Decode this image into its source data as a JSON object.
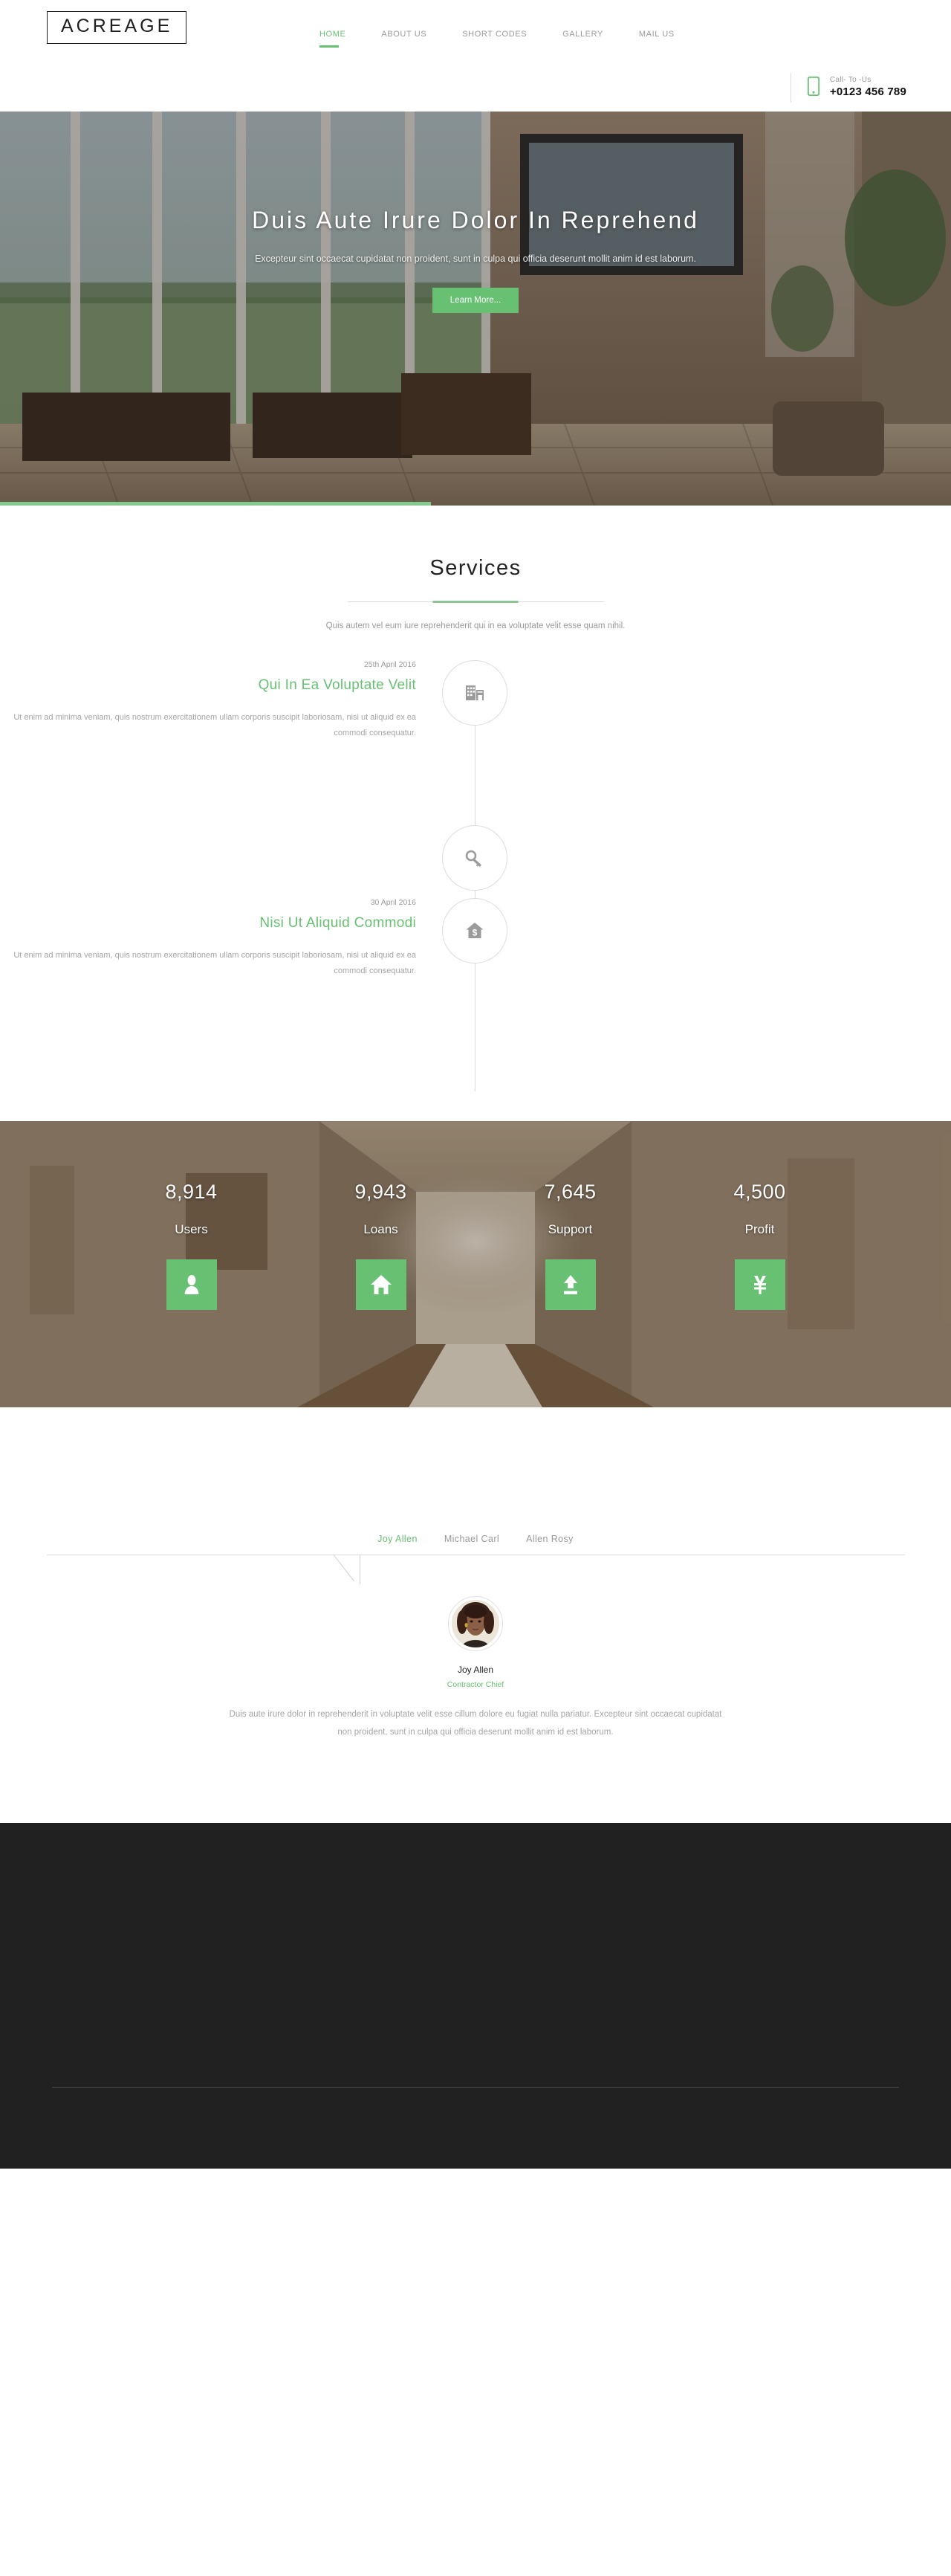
{
  "header": {
    "logo": "ACREAGE",
    "nav": [
      {
        "label": "HOME",
        "active": true
      },
      {
        "label": "ABOUT US",
        "active": false
      },
      {
        "label": "SHORT CODES",
        "active": false
      },
      {
        "label": "GALLERY",
        "active": false
      },
      {
        "label": "MAIL US",
        "active": false
      }
    ],
    "call": {
      "icon": "mobile-phone-icon",
      "label": "Call- To -Us",
      "number": "+0123 456 789"
    }
  },
  "hero": {
    "title": "Duis Aute Irure Dolor In Reprehend",
    "subtitle": "Excepteur sint occaecat cupidatat non proident, sunt in culpa qui officia deserunt mollit anim id est laborum.",
    "button": "Learn More...",
    "progress_percent": 45,
    "accent": "#68c073"
  },
  "services": {
    "title": "Services",
    "subtitle": "Quis autem vel eum iure reprehenderit qui in ea voluptate velit esse quam nihil.",
    "items": [
      {
        "date": "25th April 2016",
        "heading": "Qui In Ea Voluptate Velit",
        "body": "Ut enim ad minima veniam, quis nostrum exercitationem ullam corporis suscipit laboriosam, nisi ut aliquid ex ea commodi consequatur.",
        "icon": "office-building-icon"
      },
      {
        "date": "",
        "heading": "",
        "body": "",
        "icon": "key-icon"
      },
      {
        "date": "30 April 2016",
        "heading": "Nisi Ut Aliquid Commodi",
        "body": "Ut enim ad minima veniam, quis nostrum exercitationem ullam corporis suscipit laboriosam, nisi ut aliquid ex ea commodi consequatur.",
        "icon": "house-dollar-icon"
      }
    ]
  },
  "counters": [
    {
      "value": "8,914",
      "label": "Users",
      "icon": "user-icon"
    },
    {
      "value": "9,943",
      "label": "Loans",
      "icon": "home-icon"
    },
    {
      "value": "7,645",
      "label": "Support",
      "icon": "upload-icon"
    },
    {
      "value": "4,500",
      "label": "Profit",
      "icon": "yen-icon"
    }
  ],
  "testimonials": {
    "tabs": [
      {
        "label": "Joy Allen",
        "active": true
      },
      {
        "label": "Michael Carl",
        "active": false
      },
      {
        "label": "Allen Rosy",
        "active": false
      }
    ],
    "active": {
      "name": "Joy Allen",
      "role": "Contractor Chief",
      "quote": "Duis aute irure dolor in reprehenderit in voluptate velit esse cillum dolore eu fugiat nulla pariatur. Excepteur sint occaecat cupidatat non proident, sunt in culpa qui officia deserunt mollit anim id est laborum.",
      "avatar": "portrait-avatar"
    }
  },
  "colors": {
    "accent": "#68c073",
    "muted": "#9a9a9a",
    "footer_bg": "#212121"
  }
}
